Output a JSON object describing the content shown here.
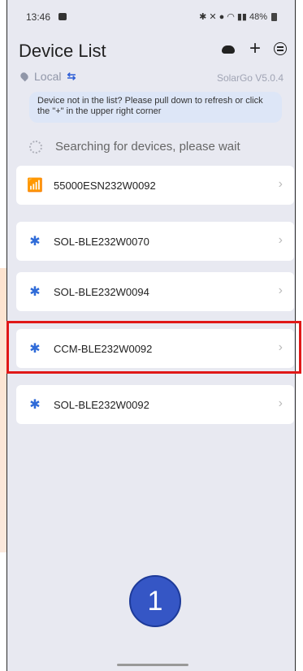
{
  "status_bar": {
    "time": "13:46",
    "right_text": "48%"
  },
  "header": {
    "title": "Device List"
  },
  "location": {
    "label": "Local",
    "version": "SolarGo V5.0.4"
  },
  "notice": {
    "text": "Device not in the list? Please pull down to refresh or click the \"+\" in the upper right corner"
  },
  "searching": {
    "text": "Searching for devices, please wait"
  },
  "devices": [
    {
      "name": "55000ESN232W0092",
      "type": "wifi-icon"
    },
    {
      "name": "SOL-BLE232W0070",
      "type": "bluetooth-icon"
    },
    {
      "name": "SOL-BLE232W0094",
      "type": "bluetooth-icon"
    },
    {
      "name": "CCM-BLE232W0092",
      "type": "bluetooth-icon"
    },
    {
      "name": "SOL-BLE232W0092",
      "type": "bluetooth-icon"
    }
  ],
  "annotation": {
    "step_number": "1",
    "highlight_color": "#e01818",
    "badge_color": "#3556c5"
  }
}
